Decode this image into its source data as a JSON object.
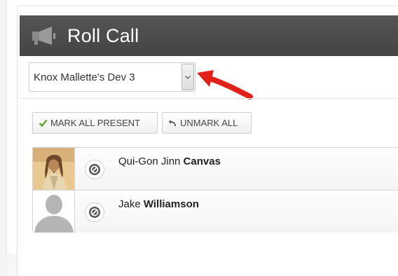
{
  "header": {
    "title": "Roll Call",
    "icon": "megaphone-icon",
    "bg_color": "#4b4b4b"
  },
  "section_select": {
    "value": "Knox Mallette's Dev 3"
  },
  "toolbar": {
    "mark_all_label": "MARK ALL PRESENT",
    "unmark_all_label": "UNMARK ALL",
    "check_color": "#5aa830"
  },
  "students": [
    {
      "first": "Qui-Gon Jinn",
      "last": "Canvas",
      "avatar": "photo",
      "status_icon": "unmarked-icon"
    },
    {
      "first": "Jake",
      "last": "Williamson",
      "avatar": "default-silhouette",
      "status_icon": "unmarked-icon"
    }
  ],
  "annotation": {
    "arrow_color": "#e0221b"
  }
}
